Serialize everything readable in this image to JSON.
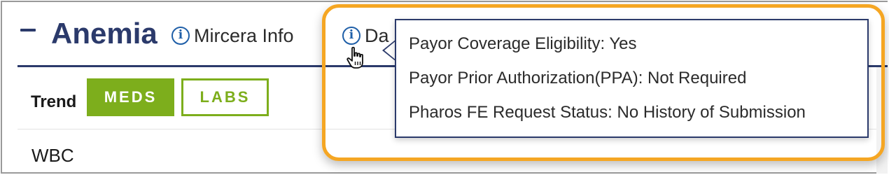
{
  "section": {
    "title": "Anemia",
    "collapse_icon": "minus-icon",
    "links": [
      {
        "label": "Mircera Info",
        "icon": "info-icon"
      },
      {
        "label": "Da",
        "icon": "info-icon"
      }
    ]
  },
  "trend": {
    "label": "Trend",
    "tabs": [
      {
        "label": "MEDS",
        "active": true
      },
      {
        "label": "LABS",
        "active": false
      }
    ]
  },
  "rows": [
    {
      "label": "WBC"
    }
  ],
  "tooltip": {
    "lines": [
      "Payor Coverage Eligibility:  Yes",
      "Payor Prior Authorization(PPA):  Not Required",
      "Pharos FE Request Status:  No History of Submission"
    ]
  },
  "cursor": "hand-pointer-icon",
  "colors": {
    "title": "#2b3a6b",
    "info_icon": "#1f5fa8",
    "pill_green": "#7dae1c",
    "highlight_orange": "#f5a623"
  }
}
